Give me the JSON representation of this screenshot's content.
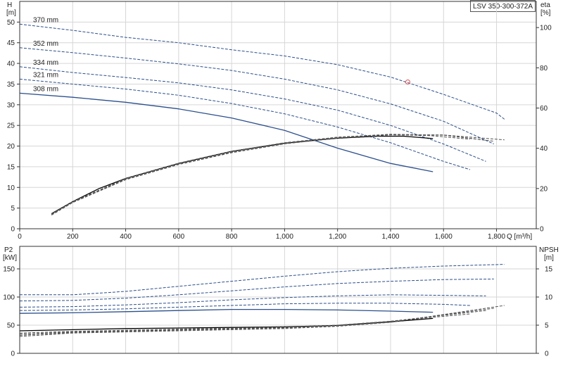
{
  "chart_data": [
    {
      "type": "line",
      "panel": "head-efficiency",
      "model": "LSV 350-300-372A",
      "xlabel": "Q [m³/h]",
      "ylabel": "H [m]",
      "ylabel_top": "H",
      "ylabel_unit": "[m]",
      "y2label_top": "eta",
      "y2label_unit": "[%]",
      "xlim": [
        0,
        1950
      ],
      "ylim": [
        0,
        55
      ],
      "y2lim": [
        0,
        113
      ],
      "x_ticks": [
        {
          "v": 0,
          "t": "0"
        },
        {
          "v": 200,
          "t": "200"
        },
        {
          "v": 400,
          "t": "400"
        },
        {
          "v": 600,
          "t": "600"
        },
        {
          "v": 800,
          "t": "800"
        },
        {
          "v": 1000,
          "t": "1,000"
        },
        {
          "v": 1200,
          "t": "1,200"
        },
        {
          "v": 1400,
          "t": "1,400"
        },
        {
          "v": 1600,
          "t": "1,600"
        },
        {
          "v": 1800,
          "t": "1,800"
        }
      ],
      "y_ticks": [
        {
          "v": 0,
          "t": "0"
        },
        {
          "v": 5,
          "t": "5"
        },
        {
          "v": 10,
          "t": "10"
        },
        {
          "v": 15,
          "t": "15"
        },
        {
          "v": 20,
          "t": "20"
        },
        {
          "v": 25,
          "t": "25"
        },
        {
          "v": 30,
          "t": "30"
        },
        {
          "v": 35,
          "t": "35"
        },
        {
          "v": 40,
          "t": "40"
        },
        {
          "v": 45,
          "t": "45"
        },
        {
          "v": 50,
          "t": "50"
        }
      ],
      "y2_ticks": [
        {
          "v": 0,
          "t": "0"
        },
        {
          "v": 20,
          "t": "20"
        },
        {
          "v": 40,
          "t": "40"
        },
        {
          "v": 60,
          "t": "60"
        },
        {
          "v": 80,
          "t": "80"
        },
        {
          "v": 100,
          "t": "100"
        }
      ],
      "head_series": [
        {
          "name": "370 mm",
          "style": "dash",
          "color": "#2b4f8c",
          "x": [
            0,
            200,
            400,
            600,
            800,
            1000,
            1200,
            1400,
            1600,
            1800,
            1830
          ],
          "y": [
            49.5,
            48.0,
            46.3,
            45.0,
            43.3,
            41.8,
            39.7,
            36.7,
            32.5,
            28.0,
            26.5
          ]
        },
        {
          "name": "352 mm",
          "style": "dash",
          "color": "#2b4f8c",
          "x": [
            0,
            200,
            400,
            600,
            800,
            1000,
            1200,
            1400,
            1600,
            1790
          ],
          "y": [
            43.8,
            42.6,
            41.3,
            39.9,
            38.3,
            36.2,
            33.6,
            30.2,
            26.0,
            20.5
          ]
        },
        {
          "name": "334 mm",
          "style": "dash",
          "color": "#2b4f8c",
          "x": [
            0,
            200,
            400,
            600,
            800,
            1000,
            1200,
            1400,
            1600,
            1760
          ],
          "y": [
            39.2,
            37.8,
            36.6,
            35.3,
            33.6,
            31.4,
            28.7,
            25.0,
            20.5,
            16.3
          ]
        },
        {
          "name": "321 mm",
          "style": "dash",
          "color": "#2b4f8c",
          "x": [
            0,
            200,
            400,
            600,
            800,
            1000,
            1200,
            1400,
            1600,
            1700
          ],
          "y": [
            36.2,
            35.0,
            33.8,
            32.3,
            30.3,
            27.8,
            24.6,
            20.8,
            16.3,
            14.3
          ]
        },
        {
          "name": "308 mm",
          "style": "solid",
          "color": "#2b4f8c",
          "x": [
            0,
            200,
            400,
            600,
            800,
            1000,
            1200,
            1400,
            1560
          ],
          "y": [
            32.8,
            31.8,
            30.6,
            29.0,
            26.8,
            23.8,
            19.5,
            15.8,
            13.8
          ]
        }
      ],
      "eta_series": [
        {
          "name": "eta 308 mm",
          "style": "solid",
          "color": "#000000",
          "x": [
            120,
            200,
            300,
            400,
            600,
            800,
            1000,
            1200,
            1350,
            1450,
            1560
          ],
          "y": [
            7.5,
            13.5,
            20.0,
            25.0,
            32.5,
            38.5,
            42.5,
            45.0,
            46.0,
            46.0,
            44.8
          ]
        },
        {
          "name": "eta 321 mm",
          "style": "dash",
          "color": "#555555",
          "x": [
            120,
            200,
            400,
            600,
            800,
            1000,
            1200,
            1400,
            1550,
            1700
          ],
          "y": [
            7.3,
            13.5,
            25.0,
            32.5,
            38.5,
            42.8,
            45.5,
            46.7,
            46.3,
            44.5
          ]
        },
        {
          "name": "eta 334 mm",
          "style": "dash",
          "color": "#555555",
          "x": [
            120,
            200,
            400,
            600,
            800,
            1000,
            1200,
            1400,
            1600,
            1760
          ],
          "y": [
            7.2,
            13.3,
            24.8,
            32.3,
            38.2,
            42.6,
            45.5,
            47.0,
            46.5,
            44.0
          ]
        },
        {
          "name": "eta 352 mm",
          "style": "dash",
          "color": "#555555",
          "x": [
            120,
            200,
            400,
            600,
            800,
            1000,
            1200,
            1400,
            1600,
            1790
          ],
          "y": [
            7.0,
            13.2,
            24.6,
            32.1,
            38.0,
            42.4,
            45.3,
            46.8,
            46.6,
            43.5
          ]
        },
        {
          "name": "eta 370 mm",
          "style": "dash",
          "color": "#555555",
          "x": [
            120,
            200,
            400,
            600,
            800,
            1000,
            1200,
            1400,
            1600,
            1830
          ],
          "y": [
            6.8,
            13.0,
            24.4,
            31.9,
            37.8,
            42.2,
            45.1,
            46.6,
            46.6,
            44.2
          ]
        }
      ],
      "marker": {
        "x": 1465,
        "y": 35.5,
        "color": "#e05050"
      }
    },
    {
      "type": "line",
      "panel": "power-npsh",
      "xlim": [
        0,
        1950
      ],
      "ylabel_top": "P2",
      "ylabel_unit": "[kW]",
      "y2label_top": "NPSH",
      "y2label_unit": "[m]",
      "ylim": [
        0,
        190
      ],
      "y2lim": [
        0,
        19
      ],
      "y_ticks": [
        {
          "v": 0,
          "t": "0"
        },
        {
          "v": 50,
          "t": "50"
        },
        {
          "v": 100,
          "t": "100"
        },
        {
          "v": 150,
          "t": "150"
        }
      ],
      "y2_ticks": [
        {
          "v": 0,
          "t": "0"
        },
        {
          "v": 5,
          "t": "5"
        },
        {
          "v": 10,
          "t": "10"
        },
        {
          "v": 15,
          "t": "15"
        }
      ],
      "power_series": [
        {
          "name": "P2 370 mm",
          "style": "dash",
          "color": "#2b4f8c",
          "x": [
            0,
            200,
            400,
            600,
            800,
            1000,
            1200,
            1400,
            1600,
            1830
          ],
          "y": [
            104,
            104,
            110,
            119,
            128,
            137,
            145,
            151,
            155,
            158
          ]
        },
        {
          "name": "P2 352 mm",
          "style": "dash",
          "color": "#2b4f8c",
          "x": [
            0,
            200,
            400,
            600,
            800,
            1000,
            1200,
            1400,
            1600,
            1790
          ],
          "y": [
            93,
            94,
            98,
            104,
            111,
            118,
            124,
            128,
            131,
            132
          ]
        },
        {
          "name": "P2 334 mm",
          "style": "dash",
          "color": "#2b4f8c",
          "x": [
            0,
            200,
            400,
            600,
            800,
            1000,
            1200,
            1400,
            1600,
            1760
          ],
          "y": [
            82,
            83,
            86,
            90,
            95,
            99,
            102,
            104,
            103,
            102
          ]
        },
        {
          "name": "P2 321 mm",
          "style": "dash",
          "color": "#2b4f8c",
          "x": [
            0,
            200,
            400,
            600,
            800,
            1000,
            1200,
            1400,
            1600,
            1700
          ],
          "y": [
            76,
            77,
            79,
            82,
            85,
            88,
            89,
            89,
            87,
            85
          ]
        },
        {
          "name": "P2 308 mm",
          "style": "solid",
          "color": "#2b4f8c",
          "x": [
            0,
            200,
            400,
            600,
            800,
            1000,
            1200,
            1400,
            1560
          ],
          "y": [
            71,
            72,
            74,
            76,
            78,
            78,
            77,
            75,
            73
          ]
        }
      ],
      "npsh_series": [
        {
          "name": "NPSH 308 mm",
          "style": "solid",
          "color": "#000000",
          "x": [
            0,
            200,
            400,
            600,
            800,
            1000,
            1200,
            1400,
            1560
          ],
          "y": [
            4.0,
            4.2,
            4.4,
            4.5,
            4.6,
            4.7,
            4.95,
            5.6,
            6.2
          ]
        },
        {
          "name": "NPSH 321 mm",
          "style": "dash",
          "color": "#555555",
          "x": [
            0,
            200,
            400,
            600,
            800,
            1000,
            1200,
            1400,
            1700
          ],
          "y": [
            3.6,
            3.9,
            4.1,
            4.3,
            4.5,
            4.6,
            5.0,
            5.7,
            7.0
          ]
        },
        {
          "name": "NPSH 334 mm",
          "style": "dash",
          "color": "#555555",
          "x": [
            0,
            200,
            400,
            600,
            800,
            1000,
            1200,
            1400,
            1760
          ],
          "y": [
            3.4,
            3.8,
            4.0,
            4.2,
            4.4,
            4.6,
            5.0,
            5.7,
            7.6
          ]
        },
        {
          "name": "NPSH 352 mm",
          "style": "dash",
          "color": "#555555",
          "x": [
            0,
            200,
            400,
            600,
            800,
            1000,
            1200,
            1400,
            1790
          ],
          "y": [
            3.2,
            3.7,
            3.9,
            4.1,
            4.3,
            4.5,
            4.9,
            5.6,
            8.0
          ]
        },
        {
          "name": "NPSH 370 mm",
          "style": "dash",
          "color": "#555555",
          "x": [
            0,
            200,
            400,
            600,
            800,
            1000,
            1200,
            1400,
            1830
          ],
          "y": [
            3.0,
            3.6,
            3.8,
            4.0,
            4.2,
            4.4,
            4.8,
            5.5,
            8.5
          ]
        }
      ]
    }
  ]
}
